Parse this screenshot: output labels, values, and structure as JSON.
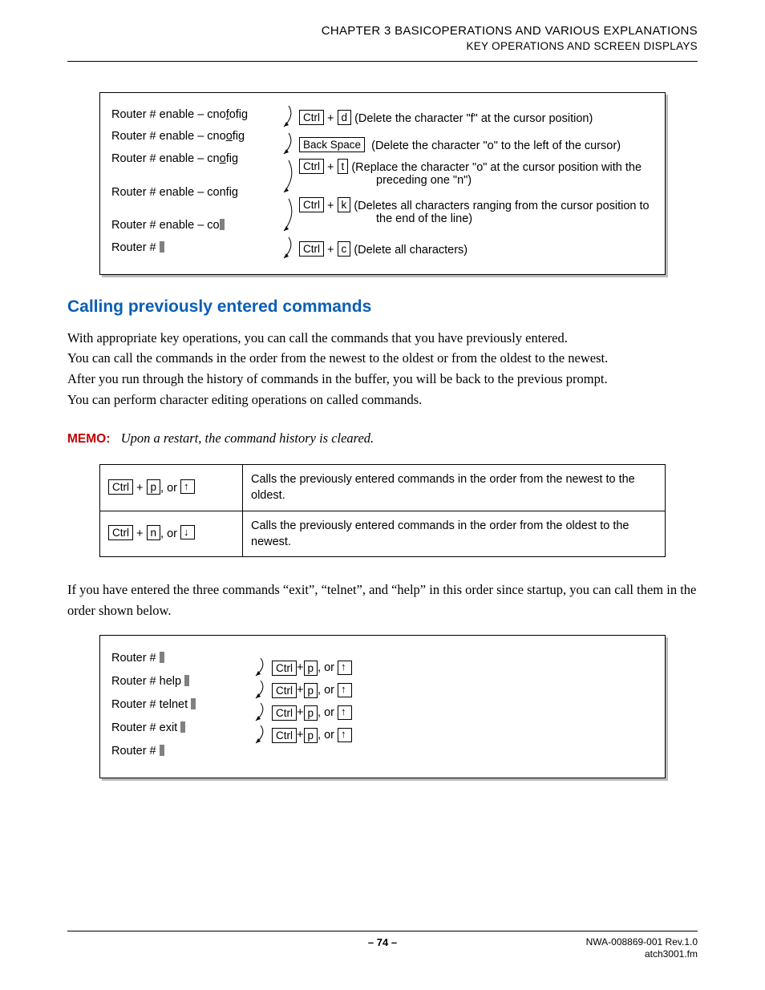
{
  "header": {
    "line1": "CHAPTER 3   BASICOPERATIONS AND VARIOUS EXPLANATIONS",
    "line2": "KEY OPERATIONS AND SCREEN DISPLAYS"
  },
  "figure1": {
    "left": [
      "Router # enable – cnofofig",
      "Router # enable – cnoofig",
      "Router # enable – cnofig",
      "Router # enable – config",
      "Router # enable – co",
      "Router # "
    ],
    "explain": [
      {
        "keys": [
          "Ctrl",
          "d"
        ],
        "sep": "+",
        "text": "(Delete the character \"f\" at the cursor position)"
      },
      {
        "keys": [
          "Back Space"
        ],
        "sep": "",
        "text": "(Delete the character \"o\" to the left of the cursor)"
      },
      {
        "keys": [
          "Ctrl",
          "t"
        ],
        "sep": "+",
        "text": "(Replace the character \"o\" at the cursor position with the",
        "cont": "preceding one \"n\")"
      },
      {
        "keys": [
          "Ctrl",
          "k"
        ],
        "sep": "+",
        "text": "(Deletes all characters ranging from the cursor position to",
        "cont": "the end of the line)"
      },
      {
        "keys": [
          "Ctrl",
          "c"
        ],
        "sep": "+",
        "text": "(Delete all characters)"
      }
    ]
  },
  "section_title": "Calling previously entered commands",
  "paragraphs": [
    "With appropriate key operations, you can call the commands that you have previously entered.",
    "You can call the commands in the order from the newest to the oldest or from the oldest to the newest.",
    "After you run through the history of commands in the buffer, you will be back to the previous prompt.",
    "You can perform character editing operations on called commands."
  ],
  "memo": {
    "label": "MEMO:",
    "text": "Upon a restart, the command history is cleared."
  },
  "table": [
    {
      "k1": "Ctrl",
      "k2": "p",
      "arrow": "up",
      "desc": "Calls the previously entered commands in the order from the newest to the oldest."
    },
    {
      "k1": "Ctrl",
      "k2": "n",
      "arrow": "down",
      "desc": "Calls the previously entered commands in the order from the oldest to the newest."
    }
  ],
  "para2": "If you have entered the three commands “exit”, “telnet”, and “help” in this order since startup, you can call them in the order shown below.",
  "figure2": {
    "left": [
      "Router # ",
      "Router # help ",
      "Router # telnet ",
      "Router # exit ",
      "Router # "
    ],
    "right_keys": {
      "k1": "Ctrl",
      "k2": "p"
    },
    "or": ", or"
  },
  "footer": {
    "page": "– 74 –",
    "rev": "NWA-008869-001 Rev.1.0",
    "file": "atch3001.fm"
  }
}
